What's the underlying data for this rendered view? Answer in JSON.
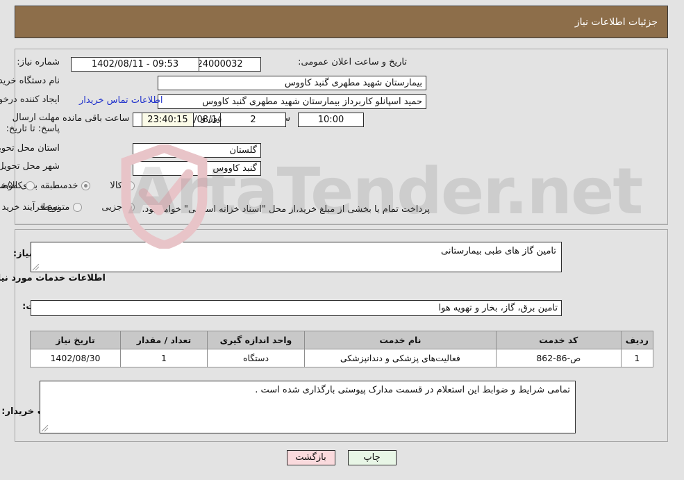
{
  "header": {
    "title": "جزئیات اطلاعات نیاز",
    "bar_color": "#8d6e4a"
  },
  "watermark": {
    "text": "ArtaTender.net",
    "shield_color": "#e8c4c8",
    "text_color": "#787878"
  },
  "top_form": {
    "need_number": {
      "label": "شماره نیاز:",
      "value": "1102091524000032"
    },
    "public_announce": {
      "label": "تاریخ و ساعت اعلان عمومی:",
      "value": "09:53 - 1402/08/11"
    },
    "buyer_org": {
      "label": "نام دستگاه خریدار:",
      "value": "بیمارستان شهید مطهری گنبد کاووس"
    },
    "request_creator": {
      "label": "ایجاد کننده درخواست:",
      "value": "حمید اسپانلو کاربرداز بیمارستان شهید مطهری گنبد کاووس"
    },
    "contact_link": "اطلاعات تماس خریدار",
    "deadline": {
      "label": "مهلت ارسال پاسخ: تا تاریخ:",
      "date": "1402/08/14",
      "time_label": "ساعت",
      "time": "10:00",
      "days": "2",
      "days_suffix": "روز و",
      "countdown": "23:40:15",
      "countdown_suffix": "ساعت باقی مانده"
    },
    "province": {
      "label": "استان محل تحویل:",
      "value": "گلستان"
    },
    "city": {
      "label": "شهر محل تحویل:",
      "value": "گنبد کاووس"
    },
    "category": {
      "label": "طبقه بندی موضوعی:",
      "options": [
        "کالا",
        "خدمت",
        "کالا/خدمت"
      ],
      "selected": "خدمت"
    },
    "process_type": {
      "label": "نوع فرآیند خرید :",
      "options": [
        "جزیی",
        "متوسط"
      ],
      "selected": "جزیی"
    },
    "treasury_note": "پرداخت تمام یا بخشی از مبلغ خرید،از محل \"اسناد خزانه اسلامی\" خواهد بود."
  },
  "mid": {
    "general_desc": {
      "label": "شرح کلی نیاز:",
      "value": "تامین گاز های طبی بیمارستانی"
    },
    "services_heading": "اطلاعات خدمات مورد نیاز",
    "service_group": {
      "label": "گروه خدمت:",
      "value": "تامین برق، گاز، بخار و تهویه هوا"
    },
    "buyer_notes": {
      "label": "توضیحات خریدار:",
      "value": "تمامی شرایط و ضوابط این استعلام در قسمت مدارک پیوستی بارگذاری شده است ."
    }
  },
  "table": {
    "headers": [
      "ردیف",
      "کد خدمت",
      "نام خدمت",
      "واحد اندازه گیری",
      "تعداد / مقدار",
      "تاریخ نیاز"
    ],
    "rows": [
      {
        "row": "1",
        "code": "ص-86-862",
        "name": "فعالیت‌های پزشکی و دندانپزشکی",
        "unit": "دستگاه",
        "qty": "1",
        "date": "1402/08/30"
      }
    ]
  },
  "footer": {
    "print_label": "چاپ",
    "back_label": "بازگشت"
  }
}
